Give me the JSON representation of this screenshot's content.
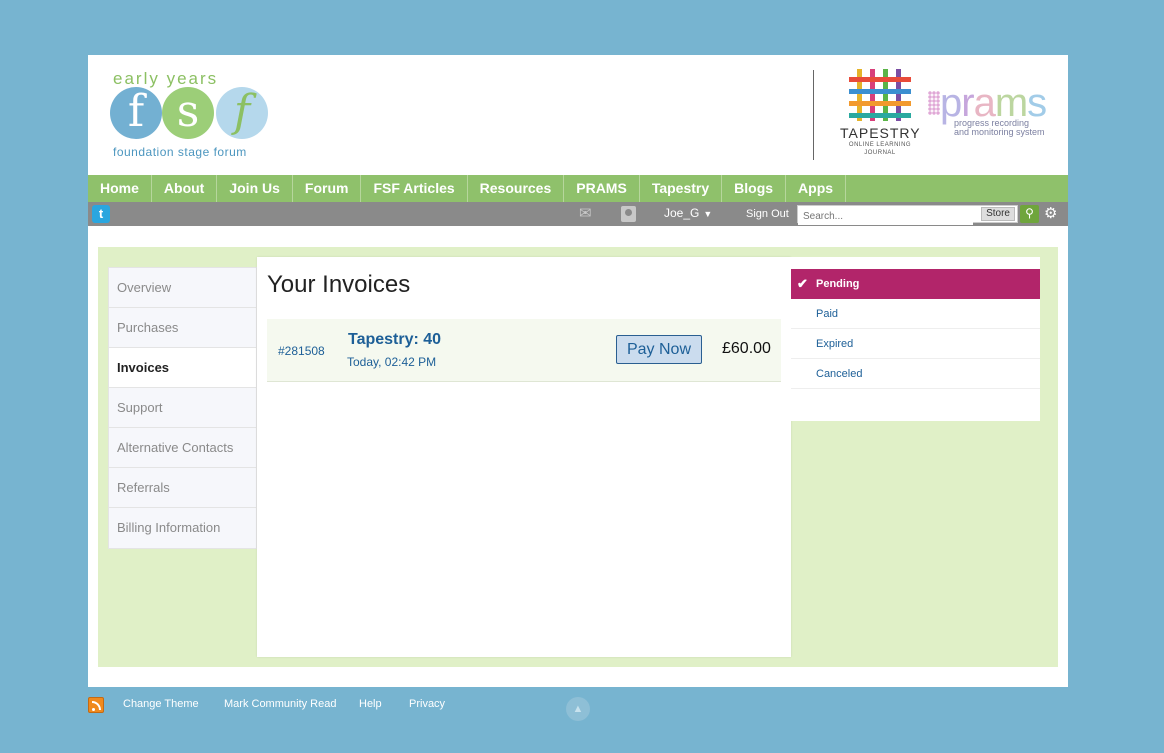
{
  "header": {
    "fsf_logo": {
      "top": "early years",
      "letters": [
        "f",
        "s",
        "f"
      ],
      "bottom": "foundation stage forum"
    },
    "tapestry_logo": {
      "name": "TAPESTRY",
      "sub1": "ONLINE LEARNING",
      "sub2": "JOURNAL"
    },
    "prams_logo": {
      "letters": [
        "p",
        "r",
        "a",
        "m",
        "s"
      ],
      "tag1": "progress recording",
      "tag2": "and monitoring system"
    }
  },
  "nav": {
    "items": [
      "Home",
      "About",
      "Join Us",
      "Forum",
      "FSF Articles",
      "Resources",
      "PRAMS",
      "Tapestry",
      "Blogs",
      "Apps"
    ]
  },
  "subnav": {
    "twitter_glyph": "t",
    "mail_glyph": "✉",
    "username": "Joe_G",
    "chevron": "▼",
    "sign_out": "Sign Out",
    "search_placeholder": "Search...",
    "store_label": "Store",
    "search_glyph": "⚲",
    "gear_glyph": "⚙"
  },
  "sidenav": {
    "items": [
      "Overview",
      "Purchases",
      "Invoices",
      "Support",
      "Alternative Contacts",
      "Referrals",
      "Billing Information"
    ],
    "active": "Invoices"
  },
  "main": {
    "title": "Your Invoices",
    "invoices": [
      {
        "id": "#281508",
        "title": "Tapestry: 40",
        "date": "Today, 02:42 PM",
        "action": "Pay Now",
        "amount": "£60.00"
      }
    ]
  },
  "filters": {
    "items": [
      "Pending",
      "Paid",
      "Expired",
      "Canceled"
    ],
    "active": "Pending",
    "check_glyph": "✔"
  },
  "footer": {
    "links": [
      "Change Theme",
      "Mark Community Read",
      "Help",
      "Privacy"
    ],
    "scroll_glyph": "▲"
  },
  "colors": {
    "background": "#77b4d0",
    "nav_green": "#8fc16b",
    "content_green": "#e0f0c7",
    "link_blue": "#1d5f97",
    "pending_magenta": "#b2256a"
  }
}
